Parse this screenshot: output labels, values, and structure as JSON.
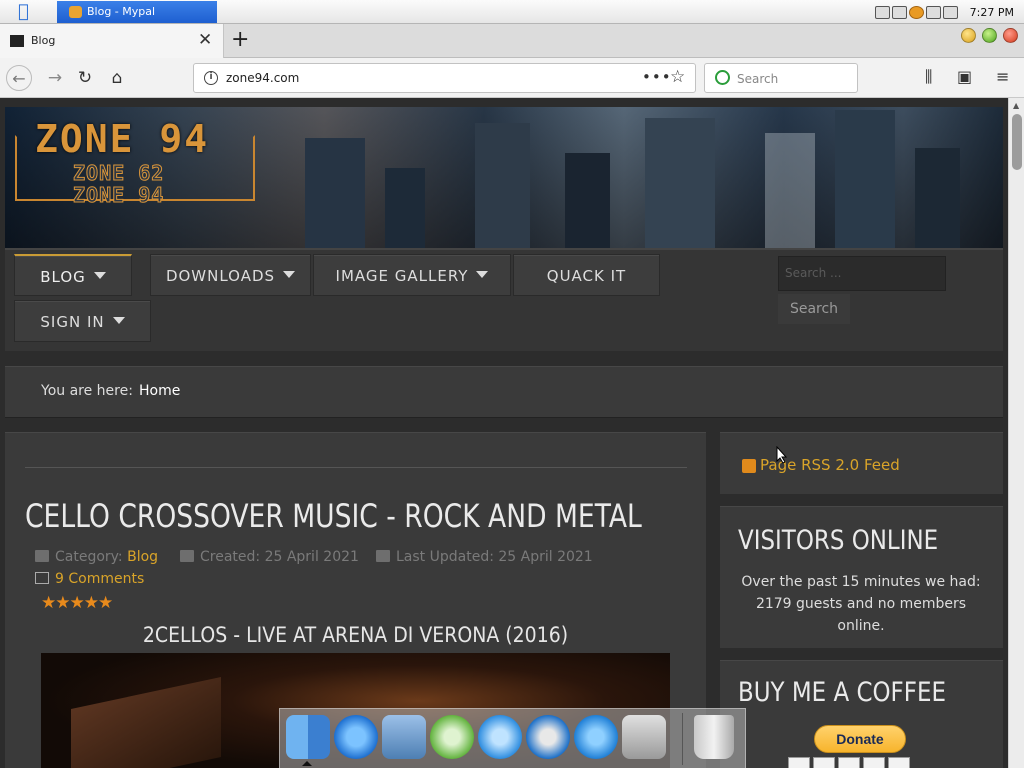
{
  "menubar": {
    "app_title": "Blog - Mypal",
    "clock": "7:27 PM"
  },
  "browser": {
    "tab_title": "Blog",
    "url": "zone94.com",
    "search_placeholder": "Search"
  },
  "site": {
    "logo_main": "ZONE 94",
    "logo_sub_1": "ZONE 62",
    "logo_sub_2": "ZONE 94",
    "nav": {
      "blog": "BLOG",
      "downloads": "DOWNLOADS",
      "image_gallery": "IMAGE GALLERY",
      "quack_it": "QUACK IT",
      "sign_in": "SIGN IN"
    },
    "search_placeholder": "Search ...",
    "search_button": "Search",
    "breadcrumb_label": "You are here:",
    "breadcrumb_home": "Home"
  },
  "article": {
    "title": "CELLO CROSSOVER MUSIC - ROCK AND METAL",
    "category_label": "Category:",
    "category_value": "Blog",
    "created": "Created: 25 April 2021",
    "updated": "Last Updated: 25 April 2021",
    "comments": "9 Comments",
    "rating": "★★★★★",
    "video_title": "2CELLOS - LIVE AT ARENA DI VERONA (2016)"
  },
  "sidebar": {
    "rss": "Page RSS 2.0 Feed",
    "visitors_heading": "VISITORS ONLINE",
    "visitors_text": "Over the past 15 minutes we had: 2179 guests and no members online.",
    "coffee_heading": "BUY ME A COFFEE",
    "donate": "Donate"
  },
  "icons": {
    "back": "back-arrow-icon",
    "forward": "forward-arrow-icon",
    "reload": "reload-icon",
    "home": "home-icon",
    "bookmark": "star-icon",
    "library": "library-icon",
    "sidebar": "sidebar-icon",
    "menu": "hamburger-icon"
  },
  "colors": {
    "accent": "#d9a429",
    "page_bg": "#2c2c2c",
    "panel_bg": "#3a3a3a"
  }
}
